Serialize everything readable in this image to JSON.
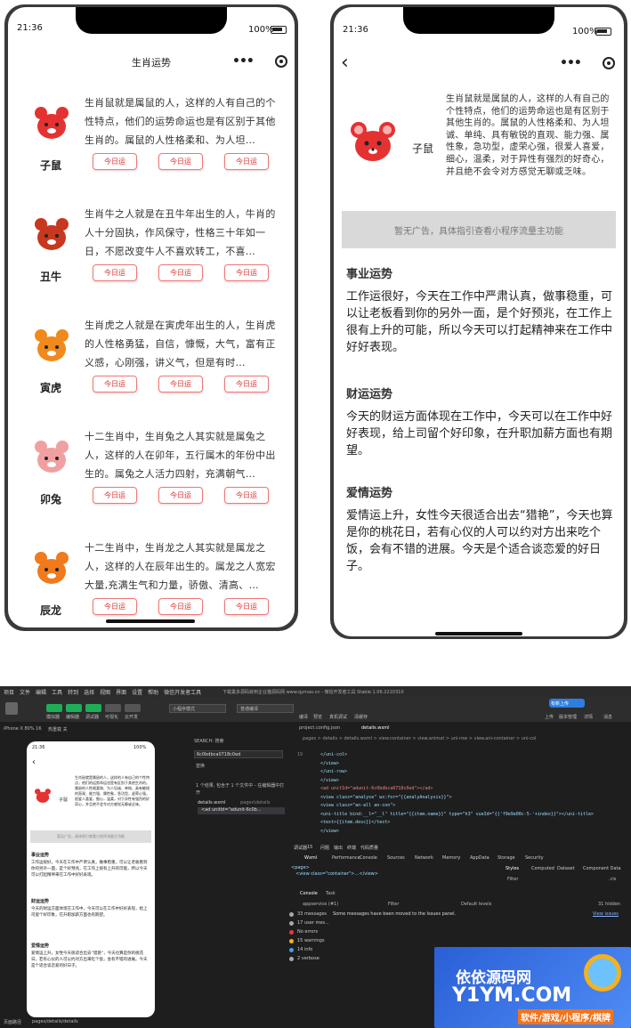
{
  "status": {
    "time": "21:36",
    "battery": "100%"
  },
  "list_page": {
    "title": "生肖运势",
    "items": [
      {
        "name": "子鼠",
        "desc": "生肖鼠就是属鼠的人，这样的人有自己的个性特点，他们的运势命运也是有区别于其他生肖的。属鼠的人性格柔和、为人坦…",
        "buttons": [
          "今日运",
          "今日运",
          "今日运"
        ],
        "color": "#e43232"
      },
      {
        "name": "丑牛",
        "desc": "生肖牛之人就是在丑牛年出生的人，牛肖的人十分固执，作风保守，性格三十年如一日，不愿改变牛人不喜欢转工，不喜…",
        "buttons": [
          "今日运",
          "今日运",
          "今日运"
        ],
        "color": "#c8371f"
      },
      {
        "name": "寅虎",
        "desc": "生肖虎之人就是在寅虎年出生的人，生肖虎的人性格勇猛，自信，慷慨，大气，富有正义感，心刚强，讲义气，但是有时…",
        "buttons": [
          "今日运",
          "今日运",
          "今日运"
        ],
        "color": "#f08a1c"
      },
      {
        "name": "卯兔",
        "desc": "十二生肖中，生肖兔之人其实就是属兔之人，这样的人在卯年，五行属木的年份中出生的。属兔之人活力四射，充满朝气…",
        "buttons": [
          "今日运",
          "今日运",
          "今日运"
        ],
        "color": "#f0a0a0"
      },
      {
        "name": "辰龙",
        "desc": "十二生肖中，生肖龙之人其实就是属龙之人，这样的人在辰年出生的。属龙之人宽宏大量,充满生气和力量，骄傲、清高、…",
        "buttons": [
          "今日运",
          "今日运",
          "今日运"
        ],
        "color": "#f07a1c"
      }
    ]
  },
  "detail_page": {
    "name": "子鼠",
    "desc": "生肖鼠就是属鼠的人，这样的人有自己的个性特点，他们的运势命运也是有区别于其他生肖的。属鼠的人性格柔和、为人坦诚、单纯、具有敏锐的直观、能力强、属性象，急功型，虚荣心强，很爱人喜爱，细心，温柔，对于异性有强烈的好奇心，并且绝不会令对方感觉无聊或乏味。",
    "ad": "暂无广告，具体指引查看小程序流量主功能",
    "sections": [
      {
        "title": "事业运势",
        "text": "工作运很好，今天在工作中严肃认真，做事稳重，可以让老板看到你的另外一面，是个好预兆，在工作上很有上升的可能，所以今天可以打起精神来在工作中好好表现。"
      },
      {
        "title": "财运运势",
        "text": "今天的财运方面体现在工作中，今天可以在工作中好好表现，给上司留个好印象，在升职加薪方面也有期望。"
      },
      {
        "title": "爱情运势",
        "text": "爱情运上升，女性今天很适合出去“猎艳”，今天也算是你的桃花日，若有心仪的人可以约对方出来吃个饭，会有不错的进展。今天是个适合谈恋爱的好日子。"
      }
    ]
  },
  "devtools": {
    "menu": [
      "项目",
      "文件",
      "编辑",
      "工具",
      "转到",
      "选择",
      "视图",
      "界面",
      "设置",
      "帮助",
      "微信开发者工具"
    ],
    "window_title": "下载巢多源码就到企业猫源码网 www.qymao.cn - 微信开发者工具 Stable 1.06.2210310",
    "toolbar_labels": [
      "模拟器",
      "编辑器",
      "调试器",
      "可视化",
      "云开发"
    ],
    "mode": "小程序模式",
    "compile": "普通编译",
    "right_labels": [
      "编译",
      "预览",
      "真机调试",
      "清缓存"
    ],
    "far_right": [
      "上传",
      "版本管理",
      "详情",
      "消息"
    ],
    "upload_badge": "有新上传",
    "device": "iPhone X 80% 16",
    "hotreload": "热重载 关",
    "search_label": "SEARCH: 搜索",
    "search_value": "6c0bdbca0718c0ed",
    "replace": "替换",
    "search_hint": "1 个结果, 包含于 1 个文件中 - 在编辑器中打开",
    "result_file": "details.wxml",
    "result_path": "pages\\details",
    "result_line": "<ad unitId=\"adunit-6c0b...",
    "editor_tabs": [
      "project.config.json",
      "details.wxml"
    ],
    "breadcrumb": "pages > details > details.wxml > view.container > view.animat > uni-row > view.ani-container > uni-col",
    "code": [
      {
        "ln": "19",
        "text": "            </uni-col>"
      },
      {
        "ln": "",
        "text": "          </view>"
      },
      {
        "ln": "",
        "text": "        </uni-row>"
      },
      {
        "ln": "",
        "text": "      </view>"
      },
      {
        "ln": "",
        "text": "      <ad unitId=\"adunit-6c0bdbca0718c0ed\"></ad>"
      },
      {
        "ln": "",
        "text": "      <view class=\"analyse\" wx:for=\"{{analyAnalysis}}\">"
      },
      {
        "ln": "",
        "text": "        <view class=\"an-all an-con\">"
      },
      {
        "ln": "",
        "text": "          <uni-title bind:__l=\"__l\" title=\"{{item.name}}\" type=\"h3\" vueId=\"{{'f9e9e00c-5-'+index}}\"></uni-title>"
      },
      {
        "ln": "",
        "text": "          <text>{{item.desc}}</text>"
      },
      {
        "ln": "",
        "text": "        </view>"
      }
    ],
    "panel_tabs": [
      "调试器",
      "15",
      "问题",
      "输出",
      "终端",
      "代码质量"
    ],
    "inspector_tabs": [
      "Wxml",
      "Performance",
      "Console",
      "Sources",
      "Network",
      "Memory",
      "AppData",
      "Storage",
      "Security"
    ],
    "styles_tabs": [
      "Styles",
      "Computed",
      "Dataset",
      "Component Data"
    ],
    "wxml_page": "<page>",
    "wxml_node": "<view class=\"container\">…</view>",
    "filter": "Filter",
    "cls": ".cls",
    "console_tabs": [
      "Console",
      "Task"
    ],
    "appservice": "appservice (#1)",
    "default_levels": "Default levels",
    "hidden": "31 hidden",
    "console_msg": "Some messages have been moved to the Issues panel.",
    "view_issues": "View issues",
    "console_groups": [
      "33 messages",
      "17 user mes...",
      "No errors",
      "15 warnings",
      "14 info",
      "2 verbose"
    ],
    "bottom_path": "pages/details/details",
    "bottom_left": "页面路径"
  },
  "watermark": {
    "line1": "依依源码网",
    "line2": "Y1YM.COM",
    "line3": "软件/游戏/小程序/棋牌"
  }
}
